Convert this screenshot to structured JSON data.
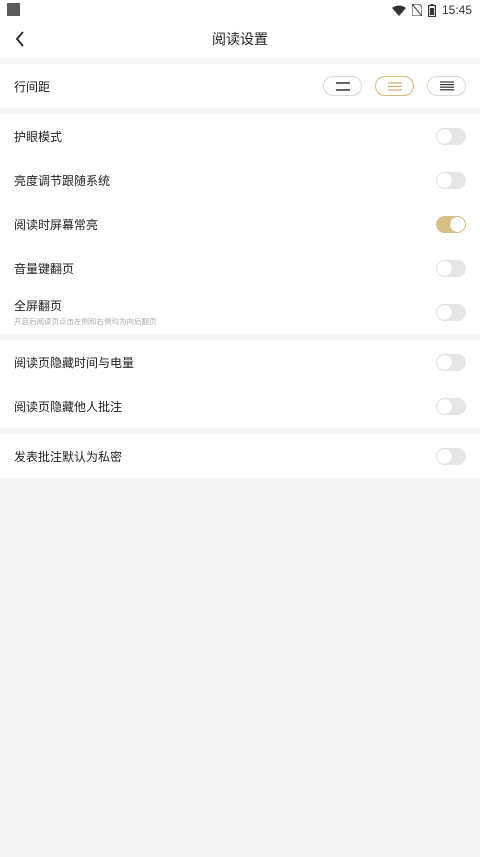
{
  "status_bar": {
    "time": "15:45"
  },
  "header": {
    "title": "阅读设置",
    "back_icon": "chevron-left-icon"
  },
  "line_spacing": {
    "label": "行间距",
    "options": [
      {
        "icon": "spacing-loose-icon",
        "selected": false
      },
      {
        "icon": "spacing-medium-icon",
        "selected": true
      },
      {
        "icon": "spacing-tight-icon",
        "selected": false
      }
    ]
  },
  "section1": [
    {
      "label": "护眼模式",
      "on": false
    },
    {
      "label": "亮度调节跟随系统",
      "on": false
    },
    {
      "label": "阅读时屏幕常亮",
      "on": true
    },
    {
      "label": "音量键翻页",
      "on": false
    },
    {
      "label": "全屏翻页",
      "sub": "开启后阅读页点击左侧和右侧均为向后翻页",
      "on": false
    }
  ],
  "section2": [
    {
      "label": "阅读页隐藏时间与电量",
      "on": false
    },
    {
      "label": "阅读页隐藏他人批注",
      "on": false
    }
  ],
  "section3": [
    {
      "label": "发表批注默认为私密",
      "on": false
    }
  ],
  "colors": {
    "accent": "#d9be84",
    "accent_border": "#d6b978",
    "toggle_off": "#e6e6e6"
  }
}
